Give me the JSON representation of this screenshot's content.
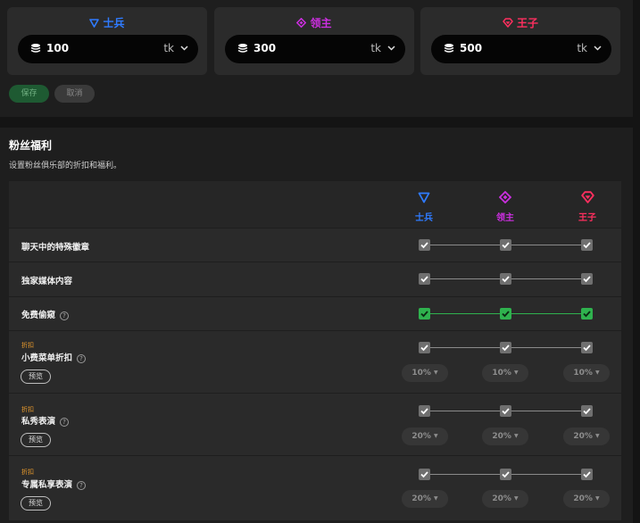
{
  "tiers": [
    {
      "name": "士兵",
      "color": "#2f7bff",
      "icon": "triangle-down-icon",
      "price": "100",
      "unit": "tk"
    },
    {
      "name": "领主",
      "color": "#cc2fe0",
      "icon": "diamond-icon",
      "price": "300",
      "unit": "tk"
    },
    {
      "name": "王子",
      "color": "#ff2f5f",
      "icon": "gem-icon",
      "price": "500",
      "unit": "tk"
    }
  ],
  "actions": {
    "save_label": "保存",
    "cancel_label": "取消"
  },
  "benefits": {
    "title": "粉丝福利",
    "subtitle": "设置粉丝俱乐部的折扣和福利。",
    "columns": [
      {
        "name": "士兵",
        "color": "#2f7bff"
      },
      {
        "name": "领主",
        "color": "#cc2fe0"
      },
      {
        "name": "王子",
        "color": "#ff2f5f"
      }
    ],
    "rows": [
      {
        "label": "聊天中的特殊徽章",
        "checked": [
          true,
          true,
          true
        ],
        "active": false
      },
      {
        "label": "独家媒体内容",
        "checked": [
          true,
          true,
          true
        ],
        "active": false
      },
      {
        "label": "免费偷窥",
        "checked": [
          true,
          true,
          true
        ],
        "active": true
      },
      {
        "tag": "折扣",
        "label": "小费菜单折扣",
        "preview": "预览",
        "checked": [
          true,
          true,
          true
        ],
        "values": [
          "10%",
          "10%",
          "10%"
        ]
      },
      {
        "tag": "折扣",
        "label": "私秀表演",
        "preview": "预览",
        "checked": [
          true,
          true,
          true
        ],
        "values": [
          "20%",
          "20%",
          "20%"
        ]
      },
      {
        "tag": "折扣",
        "label": "专属私享表演",
        "preview": "预览",
        "checked": [
          true,
          true,
          true
        ],
        "values": [
          "20%",
          "20%",
          "20%"
        ]
      }
    ]
  }
}
